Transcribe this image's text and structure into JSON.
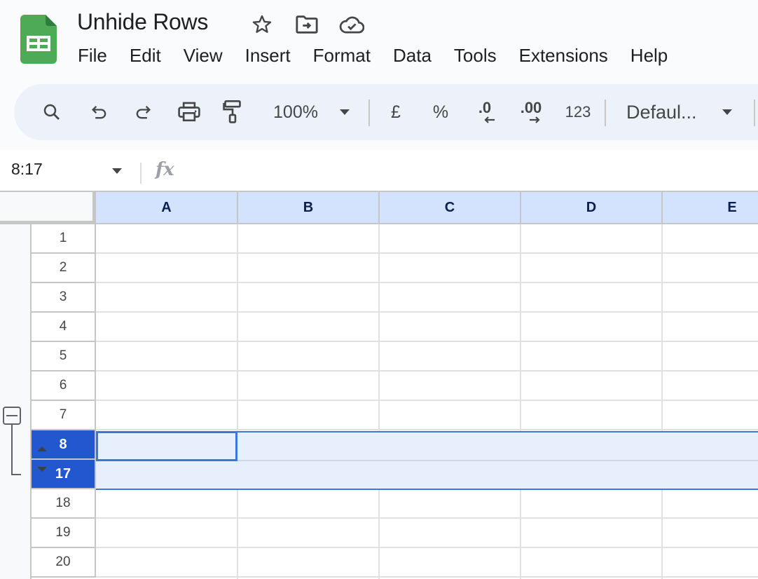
{
  "document": {
    "title": "Unhide Rows",
    "title_icons": [
      "star-icon",
      "move-to-folder-icon",
      "cloud-saved-icon"
    ]
  },
  "menu": [
    "File",
    "Edit",
    "View",
    "Insert",
    "Format",
    "Data",
    "Tools",
    "Extensions",
    "Help"
  ],
  "toolbar": {
    "icons": [
      "search-icon",
      "undo-icon",
      "redo-icon",
      "print-icon",
      "paint-format-icon"
    ],
    "zoom": "100%",
    "currency": "£",
    "percent": "%",
    "decrease_decimal": ".0",
    "increase_decimal": ".00",
    "number_format": "123",
    "font": "Defaul..."
  },
  "formula_bar": {
    "name_box": "8:17",
    "fx_label": "fx",
    "formula": ""
  },
  "grid": {
    "columns": [
      "A",
      "B",
      "C",
      "D",
      "E"
    ],
    "rows": [
      "1",
      "2",
      "3",
      "4",
      "5",
      "6",
      "7",
      "8",
      "17",
      "18",
      "19",
      "20"
    ],
    "selected_rows": [
      "8",
      "17"
    ],
    "hidden_rows_between": [
      "9",
      "16"
    ],
    "active_cell": "A8",
    "group_toggle": "collapse"
  },
  "colors": {
    "selection_header": "#2257d0",
    "selection_fill": "#e8effc",
    "selection_border": "#3a78d8",
    "column_header_selected": "#d3e3fd",
    "sheets_green": "#34a853"
  }
}
